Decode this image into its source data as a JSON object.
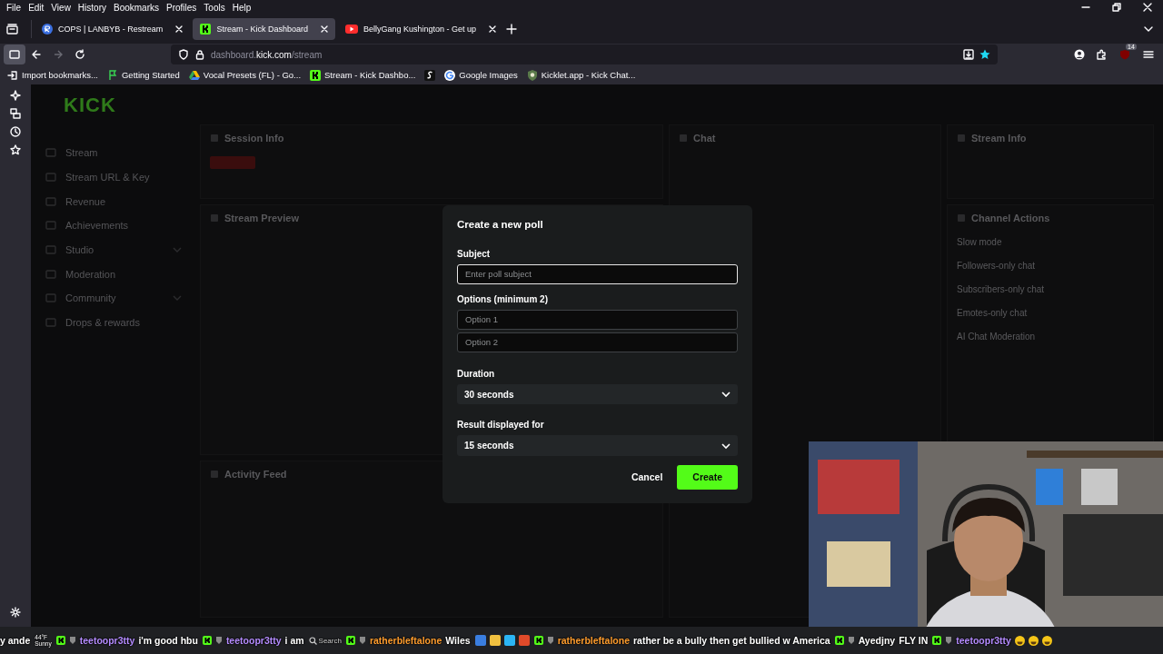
{
  "browser": {
    "menu": [
      "File",
      "Edit",
      "View",
      "History",
      "Bookmarks",
      "Profiles",
      "Tools",
      "Help"
    ],
    "tabs": [
      {
        "title": "COPS | LANBYB - Restream",
        "kind": "restream",
        "selected": false
      },
      {
        "title": "Stream - Kick Dashboard",
        "kind": "kick",
        "selected": true
      },
      {
        "title": "BellyGang Kushington - Get up",
        "kind": "video",
        "selected": false
      }
    ],
    "url": {
      "prefix": "dashboard.",
      "domain": "kick.com",
      "path": "/stream"
    },
    "bookmarks": [
      {
        "title": "Import bookmarks...",
        "kind": "import"
      },
      {
        "title": "Getting Started",
        "kind": "flag"
      },
      {
        "title": "Vocal Presets (FL) - Go...",
        "kind": "drive"
      },
      {
        "title": "Stream - Kick Dashbo...",
        "kind": "kick"
      },
      {
        "kind": "s"
      },
      {
        "title": "Google Images",
        "kind": "google"
      },
      {
        "title": "Kicklet.app - Kick Chat...",
        "kind": "kicklet"
      }
    ],
    "extension_badge": "14"
  },
  "dashboard": {
    "logo": "KICK",
    "nav": [
      {
        "label": "Stream",
        "kind": "plain"
      },
      {
        "label": "Stream URL & Key",
        "kind": "plain"
      },
      {
        "label": "Revenue",
        "kind": "plain"
      },
      {
        "label": "Achievements",
        "kind": "plain"
      },
      {
        "label": "Studio",
        "kind": "group"
      },
      {
        "label": "Moderation",
        "kind": "plain"
      },
      {
        "label": "Community",
        "kind": "group"
      },
      {
        "label": "Drops & rewards",
        "kind": "plain"
      }
    ],
    "panels": [
      {
        "title": "Session Info",
        "kind": "session"
      },
      {
        "title": "Stream Preview",
        "kind": "preview"
      },
      {
        "title": "Activity Feed",
        "kind": "activity"
      },
      {
        "title": "Chat",
        "kind": "chat"
      },
      {
        "title": "Stream Info",
        "kind": "info"
      },
      {
        "title": "Channel Actions",
        "kind": "actions"
      }
    ],
    "channel_actions": [
      "Slow mode",
      "Followers-only chat",
      "Subscribers-only chat",
      "Emotes-only chat",
      "AI Chat Moderation"
    ]
  },
  "modal": {
    "title": "Create a new poll",
    "subject_label": "Subject",
    "subject_placeholder": "Enter poll subject",
    "options_label": "Options (minimum 2)",
    "option_placeholders": [
      "Option 1",
      "Option 2"
    ],
    "duration_label": "Duration",
    "duration": "30 seconds",
    "result_label": "Result displayed for",
    "result": "15 seconds",
    "cancel": "Cancel",
    "create": "Create"
  },
  "ticker": [
    {
      "kind": "text",
      "text": "y ande"
    },
    {
      "kind": "weather",
      "temp": "44°F",
      "condition": "Sunny"
    },
    {
      "kind": "chat",
      "user": "teetoopr3tty",
      "color": "#b58cff",
      "message": "i'm good hbu"
    },
    {
      "kind": "chat",
      "user": "teetoopr3tty",
      "color": "#b58cff",
      "message": "i am"
    },
    {
      "kind": "search",
      "text": "Search"
    },
    {
      "kind": "chat",
      "user": "ratherbleftalone",
      "color": "#ff9d2e",
      "message": "Wiles"
    },
    {
      "kind": "taskbar"
    },
    {
      "kind": "chat",
      "user": "ratherbleftalone",
      "color": "#ff9d2e",
      "message": "rather be a bully then get bullied w America"
    },
    {
      "kind": "chat",
      "user": "Ayedjny",
      "color": "#ffffff",
      "message": "FLY IN"
    },
    {
      "kind": "emotes",
      "user": "teetoopr3tty",
      "color": "#b58cff"
    }
  ]
}
